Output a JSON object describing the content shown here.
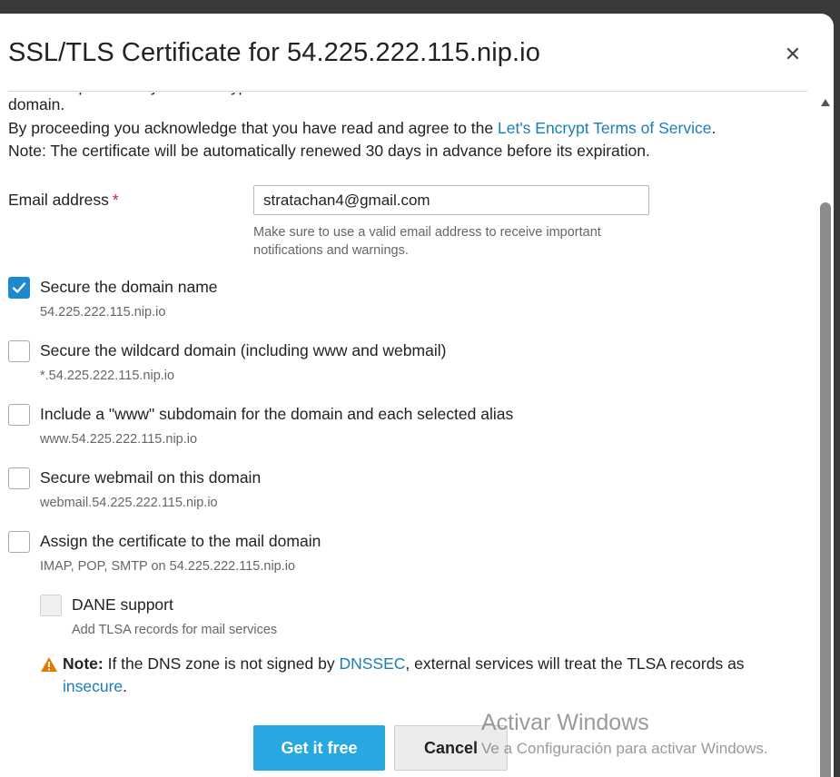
{
  "dialog": {
    "title": "SSL/TLS Certificate for 54.225.222.115.nip.io",
    "close_icon": "close-icon"
  },
  "intro": {
    "cut_line_text": "certificate provided by Let's Encrypt will be issued for the selected",
    "line_domain": "domain.",
    "line_tos_prefix": "By proceeding you acknowledge that you have read and agree to the ",
    "line_tos_link": "Let's Encrypt Terms of Service",
    "line_tos_suffix": ".",
    "line_note": "Note: The certificate will be automatically renewed 30 days in advance before its expiration."
  },
  "email": {
    "label": "Email address",
    "required_mark": "*",
    "value": "stratachan4@gmail.com",
    "hint": "Make sure to use a valid email address to receive important notifications and warnings."
  },
  "options": [
    {
      "label": "Secure the domain name",
      "sub": "54.225.222.115.nip.io",
      "checked": true
    },
    {
      "label": "Secure the wildcard domain (including www and webmail)",
      "sub": "*.54.225.222.115.nip.io",
      "checked": false
    },
    {
      "label": "Include a \"www\" subdomain for the domain and each selected alias",
      "sub": "www.54.225.222.115.nip.io",
      "checked": false
    },
    {
      "label": "Secure webmail on this domain",
      "sub": "webmail.54.225.222.115.nip.io",
      "checked": false
    },
    {
      "label": "Assign the certificate to the mail domain",
      "sub": "IMAP, POP, SMTP on 54.225.222.115.nip.io",
      "checked": false
    }
  ],
  "dane": {
    "label": "DANE support",
    "sub": "Add TLSA records for mail services",
    "checked": false,
    "disabled": true
  },
  "note": {
    "icon": "warning-icon",
    "bold": "Note:",
    "text1": " If the DNS zone is not signed by ",
    "link1": "DNSSEC",
    "text2": ", external services will treat the TLSA records as ",
    "link2": "insecure",
    "text3": "."
  },
  "buttons": {
    "primary": "Get it free",
    "secondary": "Cancel"
  },
  "watermark": {
    "line1": "Activar Windows",
    "line2": "Ve a Configuración para activar Windows."
  },
  "colors": {
    "accent": "#28a8e0",
    "link": "#1b7db8",
    "checkbox_checked": "#1c8ad1",
    "required": "#c7213c",
    "warning": "#e07b00"
  }
}
